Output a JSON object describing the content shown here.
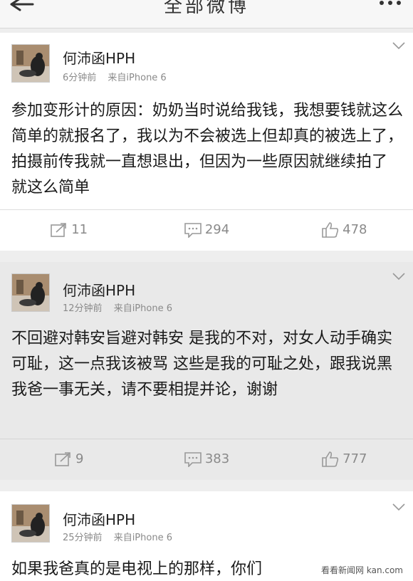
{
  "header": {
    "title": "全部微博"
  },
  "posts": [
    {
      "username": "何沛函HPH",
      "time": "6分钟前",
      "source": "来自iPhone 6",
      "text": "参加变形计的原因：奶奶当时说给我钱，我想要钱就这么简单的就报名了，我以为不会被选上但却真的被选上了，拍摄前传我就一直想退出，但因为一些原因就继续拍了 就这么简单",
      "reposts": "11",
      "comments": "294",
      "likes": "478"
    },
    {
      "username": "何沛函HPH",
      "time": "12分钟前",
      "source": "来自iPhone 6",
      "text": "不回避对韩安旨避对韩安    是我的不对，对女人动手确实可耻，这一点我该被骂 这些是我的可耻之处，跟我说黑我爸一事无关，请不要相提并论，谢谢",
      "reposts": "9",
      "comments": "383",
      "likes": "777"
    },
    {
      "username": "何沛函HPH",
      "time": "25分钟前",
      "source": "来自iPhone 6",
      "text": "如果我爸真的是电视上的那样，你们",
      "reposts": "",
      "comments": "",
      "likes": ""
    }
  ],
  "watermark": "看看新闻网 kan.com",
  "colors": {
    "meta": "#8a8a8a",
    "card": "#ffffff",
    "card_dim": "#e9e9e9",
    "background": "#eeeeee"
  }
}
